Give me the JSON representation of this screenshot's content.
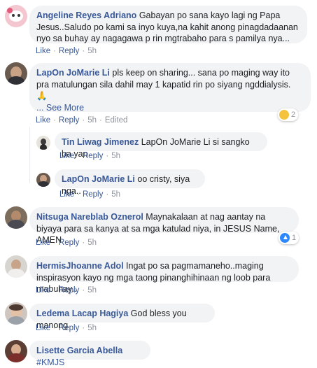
{
  "comments": [
    {
      "name": "Angeline Reyes Adriano",
      "text": "Gabayan po sana kayo lagi ng Papa Jesus..Saludo po kami sa inyo kuya,na kahit anong pinagdadaanan nyo sa buhay ay nagagawa p rin mgtrabaho para s pamilya nya...",
      "like": "Like",
      "reply": "Reply",
      "time": "5h"
    },
    {
      "name": "LapOn JoMarie Li",
      "text": "pls keep on sharing... sana po maging way ito pra matulungan sila dahil may 1 kapatid rin po siyang ngddialysis. 🙏",
      "see_more": "... See More",
      "like": "Like",
      "reply": "Reply",
      "time": "5h",
      "edited": "Edited",
      "reaction_count": "2"
    },
    {
      "name": "Tin Liwag Jimenez",
      "text": "LapOn JoMarie Li si sangko ba yan",
      "like": "Like",
      "reply": "Reply",
      "time": "5h"
    },
    {
      "name": "LapOn JoMarie Li",
      "text": "oo cristy, siya nga..",
      "like": "Like",
      "reply": "Reply",
      "time": "5h"
    },
    {
      "name": "Nitsuga Nareblab Oznerol",
      "text": "Maynakalaan at nag aantay na biyaya para sa kanya at sa mga katulad niya, in JESUS Name, AMEN",
      "like": "Like",
      "reply": "Reply",
      "time": "5h",
      "reaction_count": "1"
    },
    {
      "name": "HermisJhoanne Adol",
      "text": "Ingat po sa pagmamaneho..maging inspirasyon kayo ng mga taong pinanghihinaan ng loob para mabuhay..",
      "like": "Like",
      "reply": "Reply",
      "time": "5h"
    },
    {
      "name": "Ledema Lacap Hagiya",
      "text": "God bless you manong",
      "like": "Like",
      "reply": "Reply",
      "time": "5h"
    },
    {
      "name": "Lisette Garcia Abella",
      "text": "#KMJS"
    }
  ],
  "colors": {
    "link": "#385898",
    "bubble": "#f2f3f5",
    "meta": "#90949c"
  }
}
